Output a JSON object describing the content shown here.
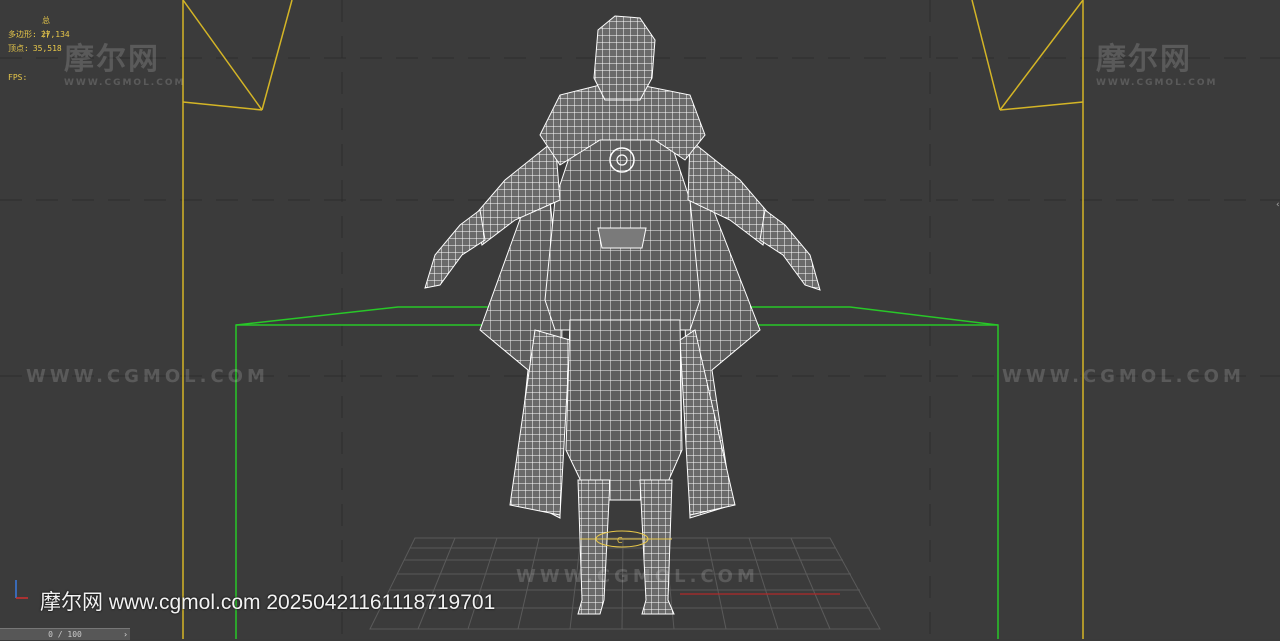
{
  "stats": {
    "total_label": "总计",
    "polys_label": "多边形:",
    "polys_value": "27,134",
    "verts_label": "顶点:",
    "verts_value": "35,518",
    "fps_label": "FPS:"
  },
  "watermark": {
    "logo": "摩尔网",
    "logo_sub": "WWW.CGMOL.COM",
    "url": "WWW.CGMOL.COM"
  },
  "credit": {
    "text": "摩尔网 www.cgmol.com 20250421161118719701"
  },
  "time_slider": {
    "label": "0 / 100"
  },
  "colors": {
    "viewport_bg": "#3b3b3b",
    "safe_frame": "#d4b526",
    "bounding_box": "#28c828",
    "wireframe": "#ffffff",
    "stats_text": "#e8c84a"
  }
}
